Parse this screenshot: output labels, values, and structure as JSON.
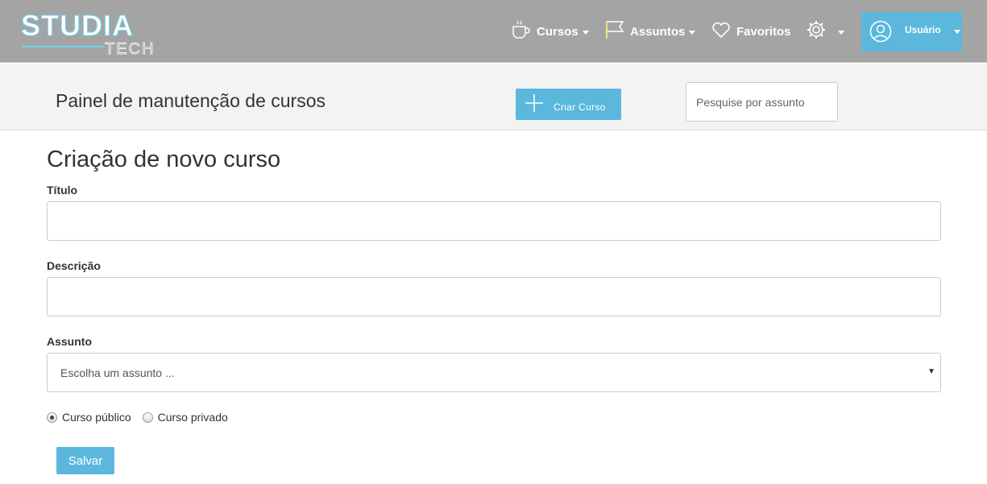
{
  "brand": {
    "name": "STUDIA",
    "sub": "TECH"
  },
  "nav": {
    "cursos": "Cursos",
    "assuntos": "Assuntos",
    "favoritos": "Favoritos",
    "user": "Usuário"
  },
  "panel": {
    "title": "Painel de manutenção de cursos",
    "create_label": "Criar Curso",
    "search_placeholder": "Pesquise por assunto"
  },
  "form": {
    "title": "Criação de novo curso",
    "titulo_label": "Título",
    "titulo_value": "",
    "descricao_label": "Descrição",
    "descricao_value": "",
    "assunto_label": "Assunto",
    "assunto_selected": "Escolha um assunto ...",
    "radio_public": "Curso público",
    "radio_private": "Curso privado",
    "selected_visibility": "public",
    "save_label": "Salvar"
  },
  "colors": {
    "navbar": "#a4a4a4",
    "accent": "#5bb8dc",
    "panel_bg": "#f3f3f3"
  },
  "icons": [
    "coffee-cup-icon",
    "flag-icon",
    "heart-icon",
    "gear-icon",
    "user-circle-icon",
    "plus-icon",
    "caret-down-icon"
  ]
}
